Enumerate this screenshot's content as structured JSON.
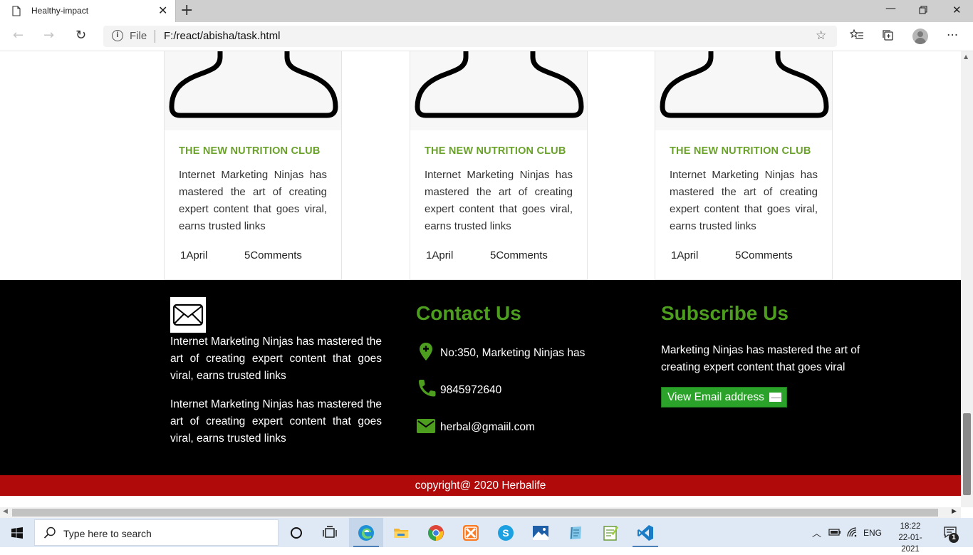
{
  "browser": {
    "tab_title": "Healthy-impact",
    "url_scheme_label": "File",
    "url": "F:/react/abisha/task.html"
  },
  "cards": [
    {
      "title": "THE NEW NUTRITION CLUB",
      "text": "Internet Marketing Ninjas has mastered the art of creating expert content that goes viral, earns trusted links",
      "date": "1April",
      "comments": "5Comments"
    },
    {
      "title": "THE NEW NUTRITION CLUB",
      "text": "Internet Marketing Ninjas has mastered the art of creating expert content that goes viral, earns trusted links",
      "date": "1April",
      "comments": "5Comments"
    },
    {
      "title": "THE NEW NUTRITION CLUB",
      "text": "Internet Marketing Ninjas has mastered the art of creating expert content that goes viral, earns trusted links",
      "date": "1April",
      "comments": "5Comments"
    }
  ],
  "footer": {
    "about": {
      "paragraph_1": "Internet Marketing Ninjas has mastered the art of creating expert content that goes viral, earns trusted links",
      "paragraph_2": "Internet Marketing Ninjas has mastered the art of creating expert content that goes viral, earns trusted links"
    },
    "contact": {
      "heading": "Contact Us",
      "address": "No:350, Marketing Ninjas has",
      "phone": "9845972640",
      "email": "herbal@gmaiil.com"
    },
    "subscribe": {
      "heading": "Subscribe Us",
      "text": "Marketing Ninjas has mastered the art of creating expert content that goes viral",
      "button_label": "View Email address"
    },
    "copyright": "copyright@ 2020 Herbalife"
  },
  "taskbar": {
    "search_placeholder": "Type here to search",
    "language": "ENG",
    "time": "18:22",
    "date": "22-01-2021",
    "notification_count": "1"
  },
  "colors": {
    "accent_green": "#4d9e1e",
    "card_title_green": "#6aa12b",
    "button_green": "#2ba229",
    "copyright_red": "#b00a0a",
    "footer_bg": "#000000"
  }
}
